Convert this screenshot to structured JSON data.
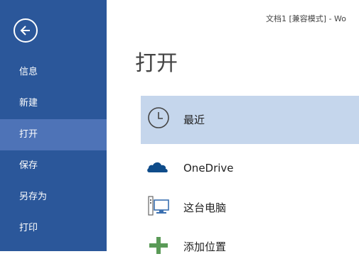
{
  "window": {
    "title": "文档1 [兼容模式] - Wo"
  },
  "sidebar": {
    "items": [
      {
        "label": "信息"
      },
      {
        "label": "新建"
      },
      {
        "label": "打开"
      },
      {
        "label": "保存"
      },
      {
        "label": "另存为"
      },
      {
        "label": "打印"
      }
    ],
    "active_index": 2,
    "bg_color": "#2b579a",
    "active_color": "#4e73b7"
  },
  "main": {
    "title": "打开",
    "locations": [
      {
        "label": "最近",
        "icon": "clock-icon",
        "selected": true
      },
      {
        "label": "OneDrive",
        "icon": "cloud-icon"
      },
      {
        "label": "这台电脑",
        "icon": "computer-icon"
      },
      {
        "label": "添加位置",
        "icon": "plus-icon"
      }
    ],
    "selected_color": "#c5d6ec"
  }
}
